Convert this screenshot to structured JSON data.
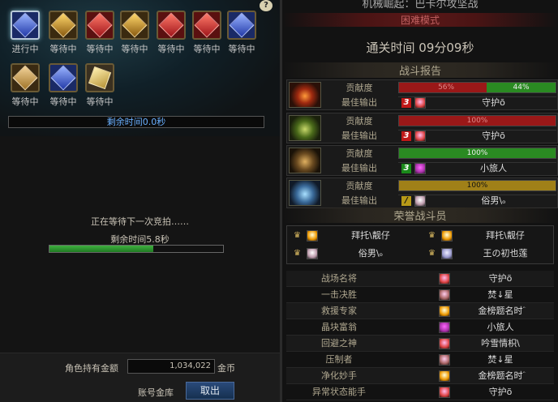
{
  "help_label": "?",
  "loot": {
    "slots": [
      {
        "status": "进行中",
        "color": "blue"
      },
      {
        "status": "等待中",
        "color": "gold"
      },
      {
        "status": "等待中",
        "color": "red"
      },
      {
        "status": "等待中",
        "color": "gold"
      },
      {
        "status": "等待中",
        "color": "red"
      },
      {
        "status": "等待中",
        "color": "red"
      },
      {
        "status": "等待中",
        "color": "blue"
      },
      {
        "status": "等待中",
        "color": "amber"
      },
      {
        "status": "等待中",
        "color": "blue"
      },
      {
        "status": "等待中",
        "color": "scroll"
      }
    ],
    "remaining_time": "剩余时间0.0秒"
  },
  "auction": {
    "waiting_text": "正在等待下一次竞拍……",
    "remaining_text": "剩余时间5.8秒",
    "progress_fraction": 0.6
  },
  "bank": {
    "gold_label": "角色持有金额",
    "gold_value": "1,034,022",
    "gold_unit": "金币",
    "account_bank_label": "账号金库",
    "withdraw_label": "取出"
  },
  "result": {
    "dungeon_title": "机械崛起：巴卡尔攻坚战",
    "difficulty": "困难模式",
    "clear_time": "通关时间    09分09秒",
    "battle_report_header": "战斗报告",
    "contribution_label": "贡献度",
    "best_output_label": "最佳输出",
    "reports": [
      {
        "portrait": "p0",
        "segments": [
          {
            "pct": 56,
            "label": "56%",
            "color": "red"
          },
          {
            "pct": 44,
            "label": "44%",
            "color": "green"
          }
        ],
        "rank": "3",
        "rank_color": "red",
        "avatar": "av-a",
        "player": "守护õ"
      },
      {
        "portrait": "p1",
        "segments": [
          {
            "pct": 100,
            "label": "100%",
            "color": "red"
          }
        ],
        "rank": "3",
        "rank_color": "red",
        "avatar": "av-a",
        "player": "守护õ"
      },
      {
        "portrait": "p2",
        "segments": [
          {
            "pct": 100,
            "label": "100%",
            "color": "green"
          }
        ],
        "rank": "3",
        "rank_color": "green",
        "avatar": "av-b",
        "player": "小旅人"
      },
      {
        "portrait": "p3",
        "segments": [
          {
            "pct": 100,
            "label": "100%",
            "color": "gold"
          }
        ],
        "rank": "/",
        "rank_color": "gold",
        "avatar": "av-c",
        "player": "俗男\\ₒ"
      }
    ],
    "honor_header": "荣誉战斗员",
    "honor": [
      {
        "avatar": "av-d",
        "name": "拜托\\靓仔"
      },
      {
        "avatar": "av-d",
        "name": "拜托\\靓仔"
      },
      {
        "avatar": "av-c",
        "name": "俗男\\ₒ"
      },
      {
        "avatar": "av-f",
        "name": "王の初也莲"
      }
    ],
    "awards": [
      {
        "title": "战场名将",
        "avatar": "av-a",
        "name": "守护õ"
      },
      {
        "title": "一击决胜",
        "avatar": "av-e",
        "name": "焚↓星"
      },
      {
        "title": "救援专家",
        "avatar": "av-d",
        "name": "金榜题名时ۧ"
      },
      {
        "title": "晶块富翁",
        "avatar": "av-b",
        "name": "小旅人"
      },
      {
        "title": "回避之神",
        "avatar": "av-a",
        "name": "吟雪情枳\\"
      },
      {
        "title": "压制者",
        "avatar": "av-e",
        "name": "焚↓星"
      },
      {
        "title": "净化妙手",
        "avatar": "av-d",
        "name": "金榜题名时ۧ"
      },
      {
        "title": "异常状态能手",
        "avatar": "av-a",
        "name": "守护õ"
      }
    ]
  }
}
